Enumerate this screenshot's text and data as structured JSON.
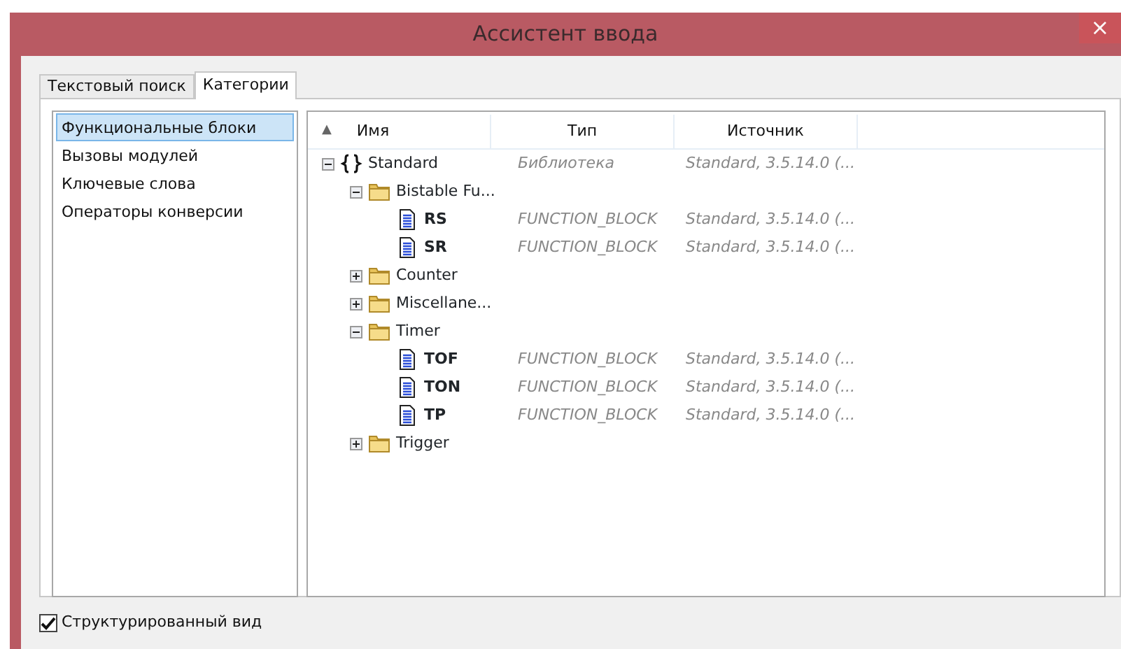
{
  "window": {
    "title": "Ассистент ввода",
    "close": "×"
  },
  "tabs": [
    {
      "label": "Текстовый поиск",
      "selected": false
    },
    {
      "label": "Категории",
      "selected": true
    }
  ],
  "categories": [
    {
      "label": "Функциональные блоки",
      "selected": true
    },
    {
      "label": "Вызовы модулей",
      "selected": false
    },
    {
      "label": "Ключевые слова",
      "selected": false
    },
    {
      "label": "Операторы конверсии",
      "selected": false
    }
  ],
  "table": {
    "sort_indicator": "▲",
    "columns": [
      "Имя",
      "Тип",
      "Источник"
    ],
    "rows": [
      {
        "kind": "library",
        "name": "Standard",
        "type": "Библиотека",
        "source": "Standard, 3.5.14.0 (...",
        "expanded": true,
        "children": [
          {
            "kind": "folder",
            "name": "Bistable Fu...",
            "expanded": true,
            "children": [
              {
                "kind": "block",
                "name": "RS",
                "type": "FUNCTION_BLOCK",
                "source": "Standard, 3.5.14.0 (..."
              },
              {
                "kind": "block",
                "name": "SR",
                "type": "FUNCTION_BLOCK",
                "source": "Standard, 3.5.14.0 (..."
              }
            ]
          },
          {
            "kind": "folder",
            "name": "Counter",
            "expanded": false
          },
          {
            "kind": "folder",
            "name": "Miscellane...",
            "expanded": false
          },
          {
            "kind": "folder",
            "name": "Timer",
            "expanded": true,
            "children": [
              {
                "kind": "block",
                "name": "TOF",
                "type": "FUNCTION_BLOCK",
                "source": "Standard, 3.5.14.0 (..."
              },
              {
                "kind": "block",
                "name": "TON",
                "type": "FUNCTION_BLOCK",
                "source": "Standard, 3.5.14.0 (..."
              },
              {
                "kind": "block",
                "name": "TP",
                "type": "FUNCTION_BLOCK",
                "source": "Standard, 3.5.14.0 (..."
              }
            ]
          },
          {
            "kind": "folder",
            "name": "Trigger",
            "expanded": false
          }
        ]
      }
    ]
  },
  "structured_view": {
    "label": "Структурированный вид",
    "checked": true
  }
}
